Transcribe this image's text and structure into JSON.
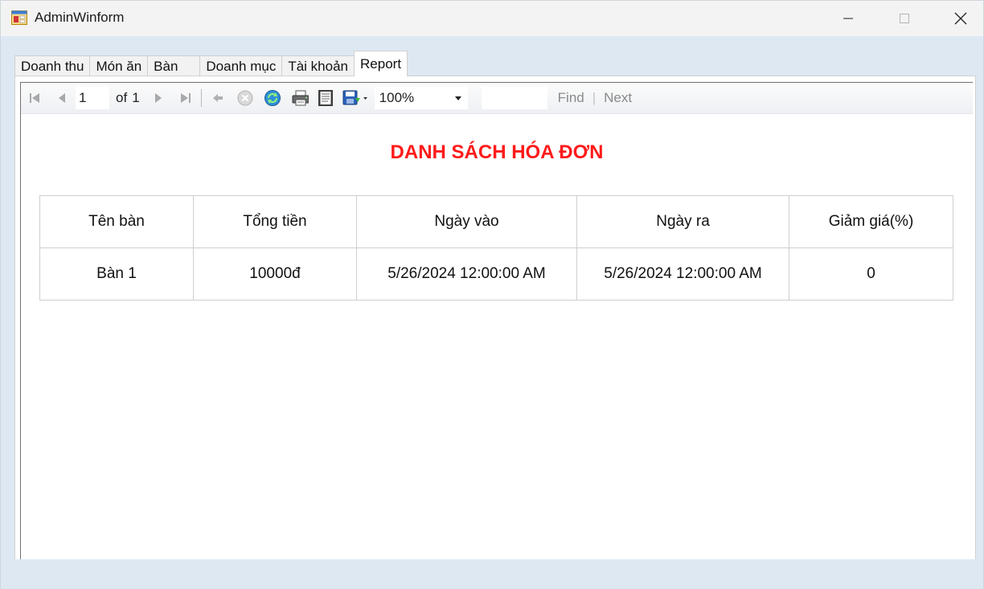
{
  "window": {
    "title": "AdminWinform",
    "icon": "form-icon"
  },
  "tabs": [
    {
      "label": "Doanh thu",
      "active": false
    },
    {
      "label": "Món ăn",
      "active": false
    },
    {
      "label": "Bàn",
      "active": false
    },
    {
      "label": "Doanh mục",
      "active": false
    },
    {
      "label": "Tài khoản",
      "active": false
    },
    {
      "label": "Report",
      "active": true
    }
  ],
  "toolbar": {
    "current_page": "1",
    "of_label": "of",
    "total_pages": "1",
    "zoom": "100%",
    "find_label": "Find",
    "separator": "|",
    "next_label": "Next"
  },
  "report": {
    "title": "DANH SÁCH HÓA ĐƠN",
    "columns": [
      "Tên bàn",
      "Tổng tiền",
      "Ngày vào",
      "Ngày ra",
      "Giảm giá(%)"
    ],
    "rows": [
      [
        "Bàn 1",
        "10000đ",
        "5/26/2024 12:00:00 AM",
        "5/26/2024 12:00:00 AM",
        "0"
      ]
    ]
  },
  "colors": {
    "title_red": "#ff1a1a",
    "client_bg": "#dde8f3"
  }
}
